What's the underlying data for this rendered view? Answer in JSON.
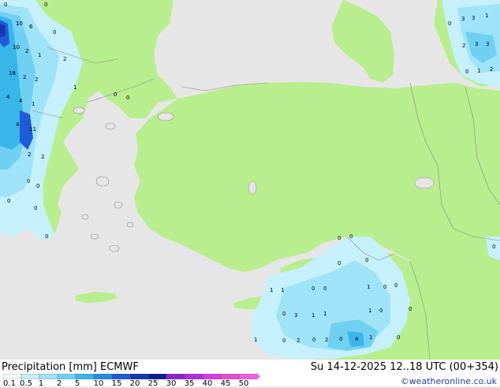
{
  "header": {
    "left_title": "Precipitation [mm]  ECMWF",
    "right_title": "Su 14-12-2025 12..18 UTC (00+354)"
  },
  "credit": "©weatheronline.co.uk",
  "legend": {
    "ticks": [
      "0.1",
      "0.5",
      "1",
      "2",
      "5",
      "10",
      "15",
      "20",
      "25",
      "30",
      "35",
      "40",
      "45",
      "50"
    ],
    "colors": [
      "#f5fbff",
      "#c6f0fb",
      "#9fe3f8",
      "#6fd0f2",
      "#3ab5ea",
      "#1f8ee0",
      "#1f5bd6",
      "#1636b5",
      "#0c1e8f",
      "#8a23d6",
      "#b12de0",
      "#d63ae6",
      "#e64fcf",
      "#f060d8"
    ]
  },
  "map": {
    "colors": {
      "sea": "#e6e6e6",
      "land": "#b8ee8e",
      "precip_light": "#c6f0fb",
      "precip_mid": "#9fe3f8",
      "precip_heavy": "#3ab5ea",
      "precip_dark": "#1f5bd6",
      "border": "#8a8a8a"
    },
    "labels": [
      {
        "text": "0"
      },
      {
        "text": "0"
      },
      {
        "text": "10"
      },
      {
        "text": "6"
      },
      {
        "text": "0"
      },
      {
        "text": "10"
      },
      {
        "text": "2"
      },
      {
        "text": "1"
      },
      {
        "text": "18"
      },
      {
        "text": "2"
      },
      {
        "text": "2"
      },
      {
        "text": "4"
      },
      {
        "text": "4"
      },
      {
        "text": "1"
      },
      {
        "text": "4"
      },
      {
        "text": "11"
      },
      {
        "text": "2"
      },
      {
        "text": "2"
      },
      {
        "text": "0"
      },
      {
        "text": "0"
      },
      {
        "text": "0"
      },
      {
        "text": "0"
      },
      {
        "text": "0"
      },
      {
        "text": "2"
      },
      {
        "text": "1"
      },
      {
        "text": "0"
      },
      {
        "text": "0"
      },
      {
        "text": "0"
      },
      {
        "text": "3"
      },
      {
        "text": "3"
      },
      {
        "text": "1"
      },
      {
        "text": "2"
      },
      {
        "text": "3"
      },
      {
        "text": "3"
      },
      {
        "text": "0"
      },
      {
        "text": "1"
      },
      {
        "text": "2"
      },
      {
        "text": "0"
      },
      {
        "text": "0"
      },
      {
        "text": "0"
      },
      {
        "text": "0"
      },
      {
        "text": "0"
      },
      {
        "text": "1"
      },
      {
        "text": "1"
      },
      {
        "text": "0"
      },
      {
        "text": "0"
      },
      {
        "text": "1"
      },
      {
        "text": "0"
      },
      {
        "text": "0"
      },
      {
        "text": "0"
      },
      {
        "text": "3"
      },
      {
        "text": "1"
      },
      {
        "text": "1"
      },
      {
        "text": "1"
      },
      {
        "text": "0"
      },
      {
        "text": "0"
      },
      {
        "text": "1"
      },
      {
        "text": "0"
      },
      {
        "text": "2"
      },
      {
        "text": "0"
      },
      {
        "text": "2"
      },
      {
        "text": "0"
      },
      {
        "text": "4"
      },
      {
        "text": "1"
      },
      {
        "text": "0"
      }
    ]
  }
}
